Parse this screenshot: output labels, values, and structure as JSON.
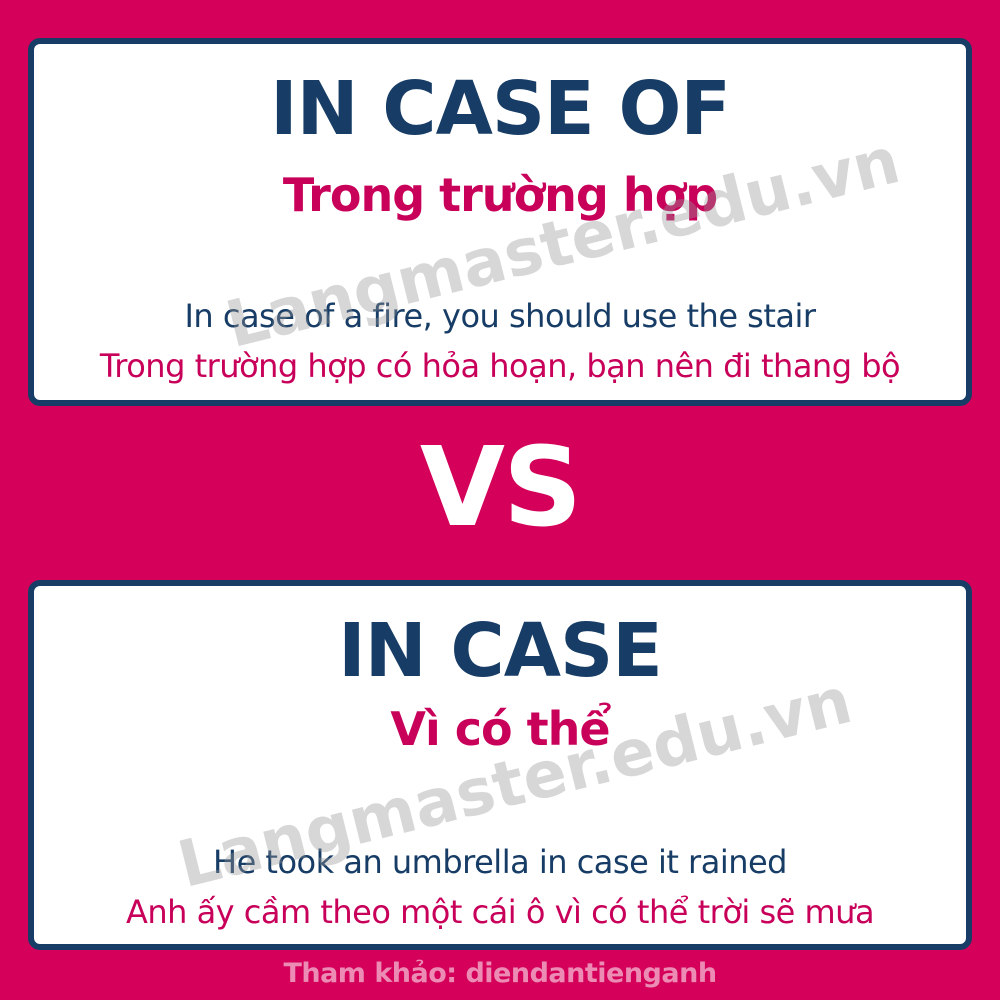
{
  "top_card": {
    "title": "IN CASE OF",
    "meaning": "Trong trường hợp",
    "example_en": "In case of a fire, you should use the stair",
    "example_vi": "Trong trường hợp có hỏa hoạn, bạn nên đi thang bộ"
  },
  "vs_label": "VS",
  "bottom_card": {
    "title": "IN CASE",
    "meaning": "Vì có thể",
    "example_en": "He took an umbrella in case it rained",
    "example_vi": "Anh ấy cầm theo một cái ô vì có thể trời sẽ mưa"
  },
  "watermark": "Langmaster.edu.vn",
  "footer": "Tham khảo: diendantienganh",
  "colors": {
    "background": "#d4005a",
    "navy": "#173d66",
    "pink": "#c8005a",
    "card": "#ffffff"
  }
}
